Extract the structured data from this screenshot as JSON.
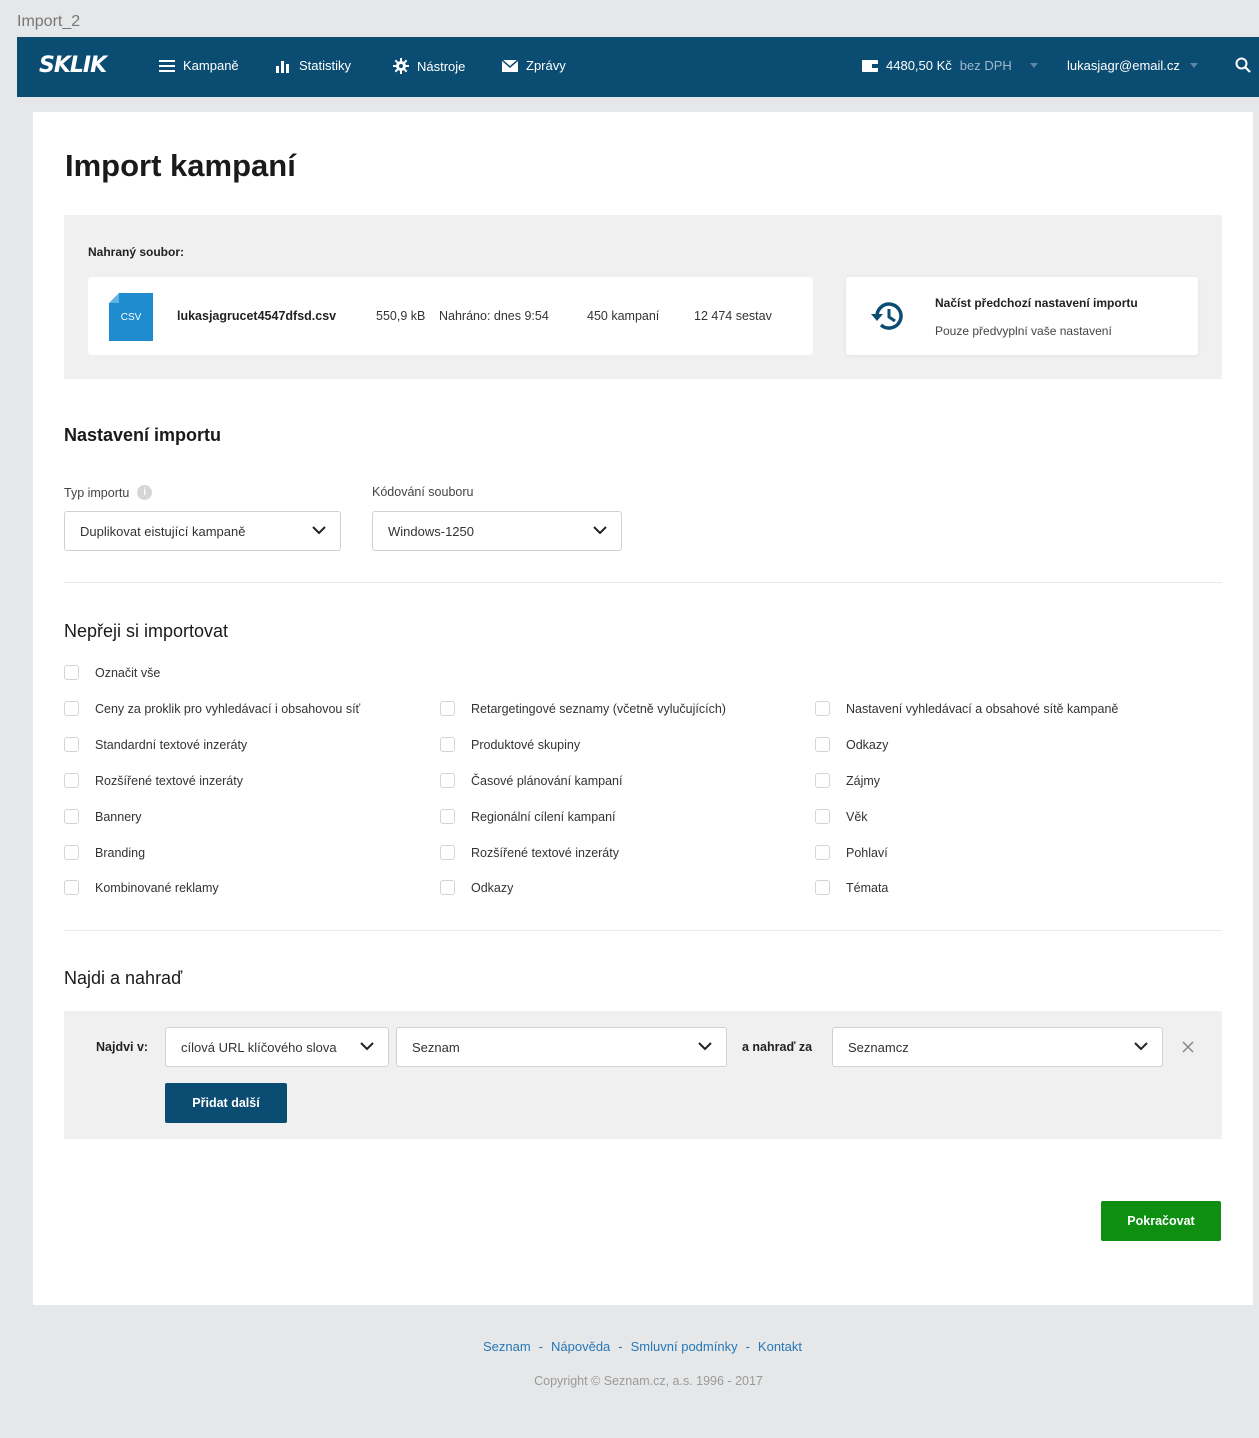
{
  "frame": {
    "label": "Import_2"
  },
  "topbar": {
    "logo": "SKLIK",
    "nav": [
      {
        "label": "Kampaně",
        "icon": "hamburger-icon"
      },
      {
        "label": "Statistiky",
        "icon": "bar-chart-icon"
      },
      {
        "label": "Nástroje",
        "icon": "gear-icon"
      },
      {
        "label": "Zprávy",
        "icon": "envelope-icon"
      }
    ],
    "credit": {
      "amount": "4480,50 Kč",
      "suffix": "bez DPH",
      "icon": "wallet-icon"
    },
    "user": "lukasjagr@email.cz",
    "search_icon": "search-icon"
  },
  "page": {
    "title": "Import kampaní"
  },
  "upload": {
    "label": "Nahraný soubor:",
    "file_type": "CSV",
    "file_name": "lukasjagrucet4547dfsd.csv",
    "size": "550,9 kB",
    "uploaded": "Nahráno: dnes 9:54",
    "campaigns": "450 kampaní",
    "sets": "12 474 sestav",
    "restore_title": "Načíst předchozí nastavení importu",
    "restore_sub": "Pouze předvyplní vaše nastavení",
    "restore_icon": "history-icon"
  },
  "settings": {
    "heading": "Nastavení importu",
    "import_type_label": "Typ importu",
    "import_type_value": "Duplikovat eistující kampaně",
    "encoding_label": "Kódování souboru",
    "encoding_value": "Windows-1250"
  },
  "exclude": {
    "heading": "Nepřeji si importovat",
    "select_all": "Označit vše",
    "col1": [
      "Ceny za proklik pro vyhledávací i obsahovou síť",
      "Standardní textové inzeráty",
      "Rozšířené textové inzeráty",
      "Bannery",
      "Branding",
      "Kombinované reklamy"
    ],
    "col2": [
      "Retargetingové seznamy (včetně vylučujících)",
      "Produktové skupiny",
      "Časové plánování kampaní",
      "Regionální cílení kampaní",
      "Rozšířené textové inzeráty",
      "Odkazy"
    ],
    "col3": [
      "Nastavení vyhledávací a obsahové sítě kampaně",
      "Odkazy",
      "Zájmy",
      "Věk",
      "Pohlaví",
      "Témata"
    ]
  },
  "find_replace": {
    "heading": "Najdi a nahraď",
    "find_in_label": "Najdvi v:",
    "find_in_value": "cílová URL klíčového slova",
    "find_value": "Seznam",
    "replace_label": "a nahraď za",
    "replace_value": "Seznamcz",
    "add_more": "Přidat další"
  },
  "actions": {
    "continue": "Pokračovat"
  },
  "footer": {
    "links": [
      "Seznam",
      "Nápověda",
      "Smluvní podmínky",
      "Kontakt"
    ],
    "separator": "-",
    "copyright": "Copyright © Seznam.cz, a.s. 1996 - 2017"
  },
  "colors": {
    "brand_dark": "#0b4c72",
    "accent_green": "#0e8f12",
    "file_icon": "#1f8ccf",
    "link": "#2678b8"
  }
}
